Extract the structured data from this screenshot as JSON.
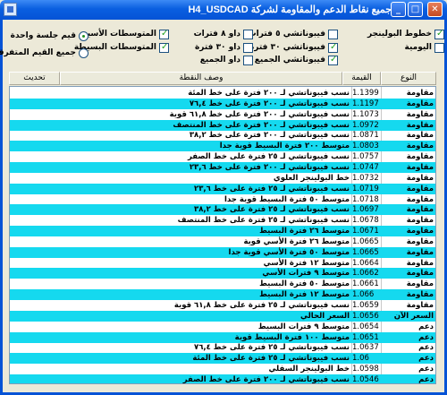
{
  "window": {
    "title": "جميع نقاط الدعم والمقاومة لشركة H4_USDCAD",
    "min_label": "_",
    "max_label": "□",
    "close_label": "✕"
  },
  "options": {
    "bollinger_lines": "خطوط البولينجر",
    "daily": "اليومية",
    "fib_5": "فيبوناتشي ٥ فترات",
    "fib_30": "فيبوناتشي ٣٠ فترة",
    "fib_all": "فيبوناتشي الجميع",
    "daw_8": "داو ٨ فترات",
    "daw_30": "داو ٣٠ فترة",
    "daw_all": "داو الجميع",
    "ma_exp": "المتوسطات الأسية",
    "ma_simple": "المتوسطات البسيطة",
    "radio_one_session": "قيم جلسة واحدة",
    "radio_all_scattered": "جميع القيم المتفرقة"
  },
  "header": {
    "type": "النوع",
    "value": "القيمة",
    "desc": "وصف النقطة",
    "refresh": "تحديث"
  },
  "rows": [
    {
      "type": "مقاومة",
      "value": "1.1399",
      "desc": "نسب فيبوناتشي لـ ٢٠٠ فترة على خط المئة"
    },
    {
      "type": "مقاومة",
      "value": "1.1197",
      "desc": "نسب فيبوناتشي لـ ٢٠٠ فترة على خط ٧٦,٤"
    },
    {
      "type": "مقاومة",
      "value": "1.1073",
      "desc": "نسب فيبوناتشي لـ ٢٠٠ فترة على خط ٦١,٨ قوية"
    },
    {
      "type": "مقاومة",
      "value": "1.0972",
      "desc": "نسب فيبوناتشي لـ ٢٠٠ فترة على خط المنتصف"
    },
    {
      "type": "مقاومة",
      "value": "1.0871",
      "desc": "نسب فيبوناتشي لـ ٢٠٠ فترة على خط ٣٨,٢"
    },
    {
      "type": "مقاومة",
      "value": "1.0803",
      "desc": "متوسط ٢٠٠ فترة البسيط قوية جدا"
    },
    {
      "type": "مقاومة",
      "value": "1.0757",
      "desc": "نسب فيبوناتشي لـ ٢٥ فترة على خط الصفر"
    },
    {
      "type": "مقاومة",
      "value": "1.0747",
      "desc": "نسب فيبوناتشي لـ ٢٠٠ فترة على خط ٢٣,٦"
    },
    {
      "type": "مقاومة",
      "value": "1.0732",
      "desc": "خط البولينجر العلوي"
    },
    {
      "type": "مقاومة",
      "value": "1.0719",
      "desc": "نسب فيبوناتشي لـ ٢٥ فترة على خط ٢٣,٦"
    },
    {
      "type": "مقاومة",
      "value": "1.0718",
      "desc": "متوسط ٥٠ فترة البسيط قوية جدا"
    },
    {
      "type": "مقاومة",
      "value": "1.0697",
      "desc": "نسب فيبوناتشي لـ ٢٥ فترة على خط ٣٨,٢"
    },
    {
      "type": "مقاومة",
      "value": "1.0678",
      "desc": "نسب فيبوناتشي لـ ٢٥ فترة على خط المنتصف"
    },
    {
      "type": "مقاومة",
      "value": "1.0671",
      "desc": "متوسط ٢٦ فترة البسيط"
    },
    {
      "type": "مقاومة",
      "value": "1.0665",
      "desc": "متوسط ٢٦ فترة الأسي قوية"
    },
    {
      "type": "مقاومة",
      "value": "1.0665",
      "desc": "متوسط ٥٠ فترة الأسي قوية جدا"
    },
    {
      "type": "مقاومة",
      "value": "1.0664",
      "desc": "متوسط ١٢ فترة الأسي"
    },
    {
      "type": "مقاومة",
      "value": "1.0662",
      "desc": "متوسط ٩ فترات الأسي"
    },
    {
      "type": "مقاومة",
      "value": "1.0661",
      "desc": "متوسط ٥٠ فترة البسيط"
    },
    {
      "type": "مقاومة",
      "value": "1.066",
      "desc": "متوسط ١٢ فترة البسيط"
    },
    {
      "type": "مقاومة",
      "value": "1.0659",
      "desc": "نسب فيبوناتشي لـ ٢٥ فترة على خط ٦١,٨ قوية"
    },
    {
      "type": "السعر الآن",
      "value": "1.0656",
      "desc": "السعر الحالي"
    },
    {
      "type": "دعم",
      "value": "1.0654",
      "desc": "متوسط ٩ فترات البسيط"
    },
    {
      "type": "دعم",
      "value": "1.0651",
      "desc": "متوسط ١٠٠ فترة البسيط قوية"
    },
    {
      "type": "دعم",
      "value": "1.0637",
      "desc": "نسب فيبوناتشي لـ ٢٥ فترة على خط ٧٦,٤"
    },
    {
      "type": "دعم",
      "value": "1.06",
      "desc": "نسب فيبوناتشي لـ ٢٥ فترة على خط المئة"
    },
    {
      "type": "دعم",
      "value": "1.0598",
      "desc": "خط البولينجر السفلي"
    },
    {
      "type": "دعم",
      "value": "1.0546",
      "desc": "نسب فيبوناتشي لـ ٢٠٠ فترة على خط الصفر"
    }
  ],
  "colors": {
    "row_alt": "#15d9ef",
    "titlebar": "#0553d6"
  }
}
